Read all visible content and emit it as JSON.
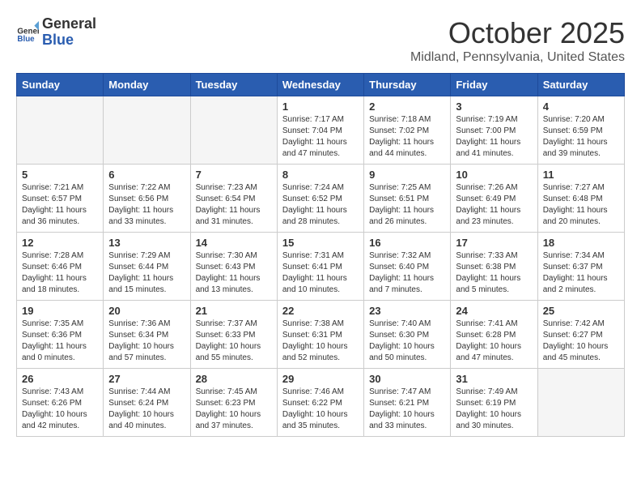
{
  "header": {
    "logo_general": "General",
    "logo_blue": "Blue",
    "month_title": "October 2025",
    "subtitle": "Midland, Pennsylvania, United States"
  },
  "weekdays": [
    "Sunday",
    "Monday",
    "Tuesday",
    "Wednesday",
    "Thursday",
    "Friday",
    "Saturday"
  ],
  "weeks": [
    [
      {
        "day": "",
        "info": ""
      },
      {
        "day": "",
        "info": ""
      },
      {
        "day": "",
        "info": ""
      },
      {
        "day": "1",
        "info": "Sunrise: 7:17 AM\nSunset: 7:04 PM\nDaylight: 11 hours and 47 minutes."
      },
      {
        "day": "2",
        "info": "Sunrise: 7:18 AM\nSunset: 7:02 PM\nDaylight: 11 hours and 44 minutes."
      },
      {
        "day": "3",
        "info": "Sunrise: 7:19 AM\nSunset: 7:00 PM\nDaylight: 11 hours and 41 minutes."
      },
      {
        "day": "4",
        "info": "Sunrise: 7:20 AM\nSunset: 6:59 PM\nDaylight: 11 hours and 39 minutes."
      }
    ],
    [
      {
        "day": "5",
        "info": "Sunrise: 7:21 AM\nSunset: 6:57 PM\nDaylight: 11 hours and 36 minutes."
      },
      {
        "day": "6",
        "info": "Sunrise: 7:22 AM\nSunset: 6:56 PM\nDaylight: 11 hours and 33 minutes."
      },
      {
        "day": "7",
        "info": "Sunrise: 7:23 AM\nSunset: 6:54 PM\nDaylight: 11 hours and 31 minutes."
      },
      {
        "day": "8",
        "info": "Sunrise: 7:24 AM\nSunset: 6:52 PM\nDaylight: 11 hours and 28 minutes."
      },
      {
        "day": "9",
        "info": "Sunrise: 7:25 AM\nSunset: 6:51 PM\nDaylight: 11 hours and 26 minutes."
      },
      {
        "day": "10",
        "info": "Sunrise: 7:26 AM\nSunset: 6:49 PM\nDaylight: 11 hours and 23 minutes."
      },
      {
        "day": "11",
        "info": "Sunrise: 7:27 AM\nSunset: 6:48 PM\nDaylight: 11 hours and 20 minutes."
      }
    ],
    [
      {
        "day": "12",
        "info": "Sunrise: 7:28 AM\nSunset: 6:46 PM\nDaylight: 11 hours and 18 minutes."
      },
      {
        "day": "13",
        "info": "Sunrise: 7:29 AM\nSunset: 6:44 PM\nDaylight: 11 hours and 15 minutes."
      },
      {
        "day": "14",
        "info": "Sunrise: 7:30 AM\nSunset: 6:43 PM\nDaylight: 11 hours and 13 minutes."
      },
      {
        "day": "15",
        "info": "Sunrise: 7:31 AM\nSunset: 6:41 PM\nDaylight: 11 hours and 10 minutes."
      },
      {
        "day": "16",
        "info": "Sunrise: 7:32 AM\nSunset: 6:40 PM\nDaylight: 11 hours and 7 minutes."
      },
      {
        "day": "17",
        "info": "Sunrise: 7:33 AM\nSunset: 6:38 PM\nDaylight: 11 hours and 5 minutes."
      },
      {
        "day": "18",
        "info": "Sunrise: 7:34 AM\nSunset: 6:37 PM\nDaylight: 11 hours and 2 minutes."
      }
    ],
    [
      {
        "day": "19",
        "info": "Sunrise: 7:35 AM\nSunset: 6:36 PM\nDaylight: 11 hours and 0 minutes."
      },
      {
        "day": "20",
        "info": "Sunrise: 7:36 AM\nSunset: 6:34 PM\nDaylight: 10 hours and 57 minutes."
      },
      {
        "day": "21",
        "info": "Sunrise: 7:37 AM\nSunset: 6:33 PM\nDaylight: 10 hours and 55 minutes."
      },
      {
        "day": "22",
        "info": "Sunrise: 7:38 AM\nSunset: 6:31 PM\nDaylight: 10 hours and 52 minutes."
      },
      {
        "day": "23",
        "info": "Sunrise: 7:40 AM\nSunset: 6:30 PM\nDaylight: 10 hours and 50 minutes."
      },
      {
        "day": "24",
        "info": "Sunrise: 7:41 AM\nSunset: 6:28 PM\nDaylight: 10 hours and 47 minutes."
      },
      {
        "day": "25",
        "info": "Sunrise: 7:42 AM\nSunset: 6:27 PM\nDaylight: 10 hours and 45 minutes."
      }
    ],
    [
      {
        "day": "26",
        "info": "Sunrise: 7:43 AM\nSunset: 6:26 PM\nDaylight: 10 hours and 42 minutes."
      },
      {
        "day": "27",
        "info": "Sunrise: 7:44 AM\nSunset: 6:24 PM\nDaylight: 10 hours and 40 minutes."
      },
      {
        "day": "28",
        "info": "Sunrise: 7:45 AM\nSunset: 6:23 PM\nDaylight: 10 hours and 37 minutes."
      },
      {
        "day": "29",
        "info": "Sunrise: 7:46 AM\nSunset: 6:22 PM\nDaylight: 10 hours and 35 minutes."
      },
      {
        "day": "30",
        "info": "Sunrise: 7:47 AM\nSunset: 6:21 PM\nDaylight: 10 hours and 33 minutes."
      },
      {
        "day": "31",
        "info": "Sunrise: 7:49 AM\nSunset: 6:19 PM\nDaylight: 10 hours and 30 minutes."
      },
      {
        "day": "",
        "info": ""
      }
    ]
  ]
}
